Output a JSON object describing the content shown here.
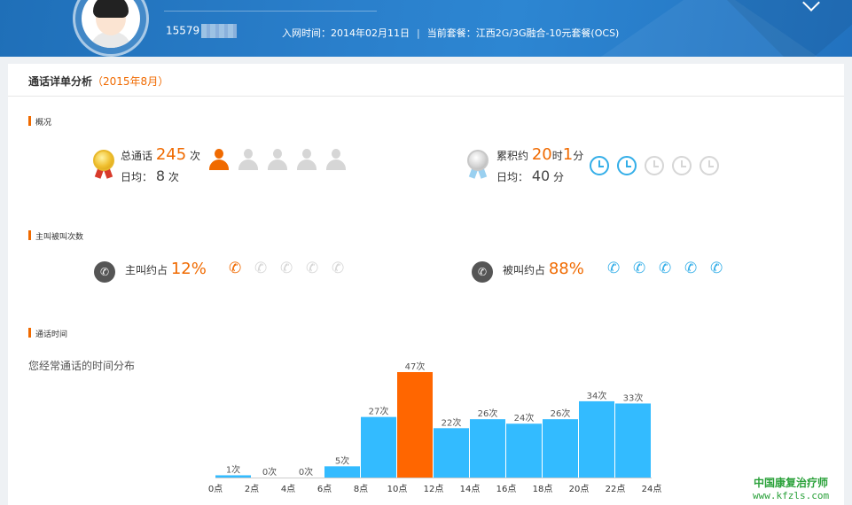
{
  "header": {
    "phone_prefix": "15579",
    "join_label": "入网时间：2014年02月11日",
    "plan_label": "当前套餐：江西2G/3G融合-10元套餐(OCS)"
  },
  "card": {
    "title": "通话详单分析",
    "month": "（2015年8月）"
  },
  "overview": {
    "section_title": "概况",
    "total_prefix": "总通话",
    "total_value": "245",
    "total_unit": "次",
    "daily_prefix": "日均：",
    "daily_value": "8",
    "daily_unit": "次",
    "people_level": 1,
    "people_total": 5,
    "duration_prefix": "累积约",
    "duration_hours": "20",
    "duration_hours_unit": "时",
    "duration_minutes": "1",
    "duration_minutes_unit": "分",
    "daily_duration_prefix": "日均：",
    "daily_duration_value": "40",
    "daily_duration_unit": "分",
    "clock_level": 2,
    "clock_total": 5
  },
  "calls": {
    "section_title": "主叫被叫次数",
    "outgoing_label": "主叫约占",
    "outgoing_value": "12%",
    "outgoing_level": 1,
    "incoming_label": "被叫约占",
    "incoming_value": "88%",
    "incoming_level": 5,
    "icon_total": 5
  },
  "time": {
    "section_title": "通话时间",
    "subtitle": "您经常通话的时间分布"
  },
  "colors": {
    "accent": "#f06a00",
    "bar": "#33bbff",
    "highlight_bar": "#ff6600",
    "clock_on": "#33aee8",
    "inactive": "#d6d6d6"
  },
  "chart_data": {
    "type": "bar",
    "categories": [
      "0点",
      "2点",
      "4点",
      "6点",
      "8点",
      "10点",
      "12点",
      "14点",
      "16点",
      "18点",
      "20点",
      "22点"
    ],
    "x_ticks": [
      "0点",
      "2点",
      "4点",
      "6点",
      "8点",
      "10点",
      "12点",
      "14点",
      "16点",
      "18点",
      "20点",
      "22点",
      "24点"
    ],
    "values": [
      1,
      0,
      0,
      5,
      27,
      47,
      22,
      26,
      24,
      26,
      34,
      33
    ],
    "data_labels": [
      "1次",
      "0次",
      "0次",
      "5次",
      "27次",
      "47次",
      "22次",
      "26次",
      "24次",
      "26次",
      "34次",
      "33次"
    ],
    "highlight_index": 5,
    "ylim": [
      0,
      47
    ],
    "grid": false
  },
  "watermark": {
    "line1": "中国康复治疗师",
    "line2": "www.kfzls.com"
  }
}
